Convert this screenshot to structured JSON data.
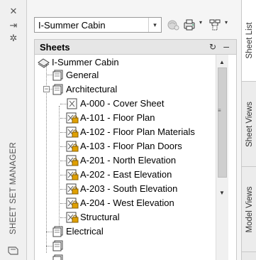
{
  "window": {
    "title": "SHEET SET MANAGER",
    "close_glyph": "✕",
    "pin_glyph": "⇥",
    "properties_glyph": "✲"
  },
  "toolbar": {
    "sheet_set_value": "I-Summer Cabin"
  },
  "sheets_panel": {
    "title": "Sheets",
    "refresh_glyph": "↻",
    "minimize_glyph": "–",
    "root": {
      "label": "I-Summer Cabin"
    },
    "items": [
      {
        "label": "General"
      },
      {
        "label": "Architectural",
        "expander": "−"
      },
      {
        "label": "A-000 - Cover Sheet"
      },
      {
        "label": "A-101 - Floor Plan"
      },
      {
        "label": "A-102 - Floor Plan Materials"
      },
      {
        "label": "A-103 - Floor Plan Doors"
      },
      {
        "label": "A-201 - North Elevation"
      },
      {
        "label": "A-202 - East Elevation"
      },
      {
        "label": "A-203 - South Elevation"
      },
      {
        "label": "A-204 - West Elevation"
      },
      {
        "label": "Structural"
      },
      {
        "label": "Electrical"
      }
    ]
  },
  "tabs": [
    {
      "label": "Sheet List",
      "active": true
    },
    {
      "label": "Sheet Views",
      "active": false
    },
    {
      "label": "Model Views",
      "active": false
    }
  ],
  "colors": {
    "accent_lock": "#e0a000",
    "panel_bg": "#f5f5f5"
  }
}
